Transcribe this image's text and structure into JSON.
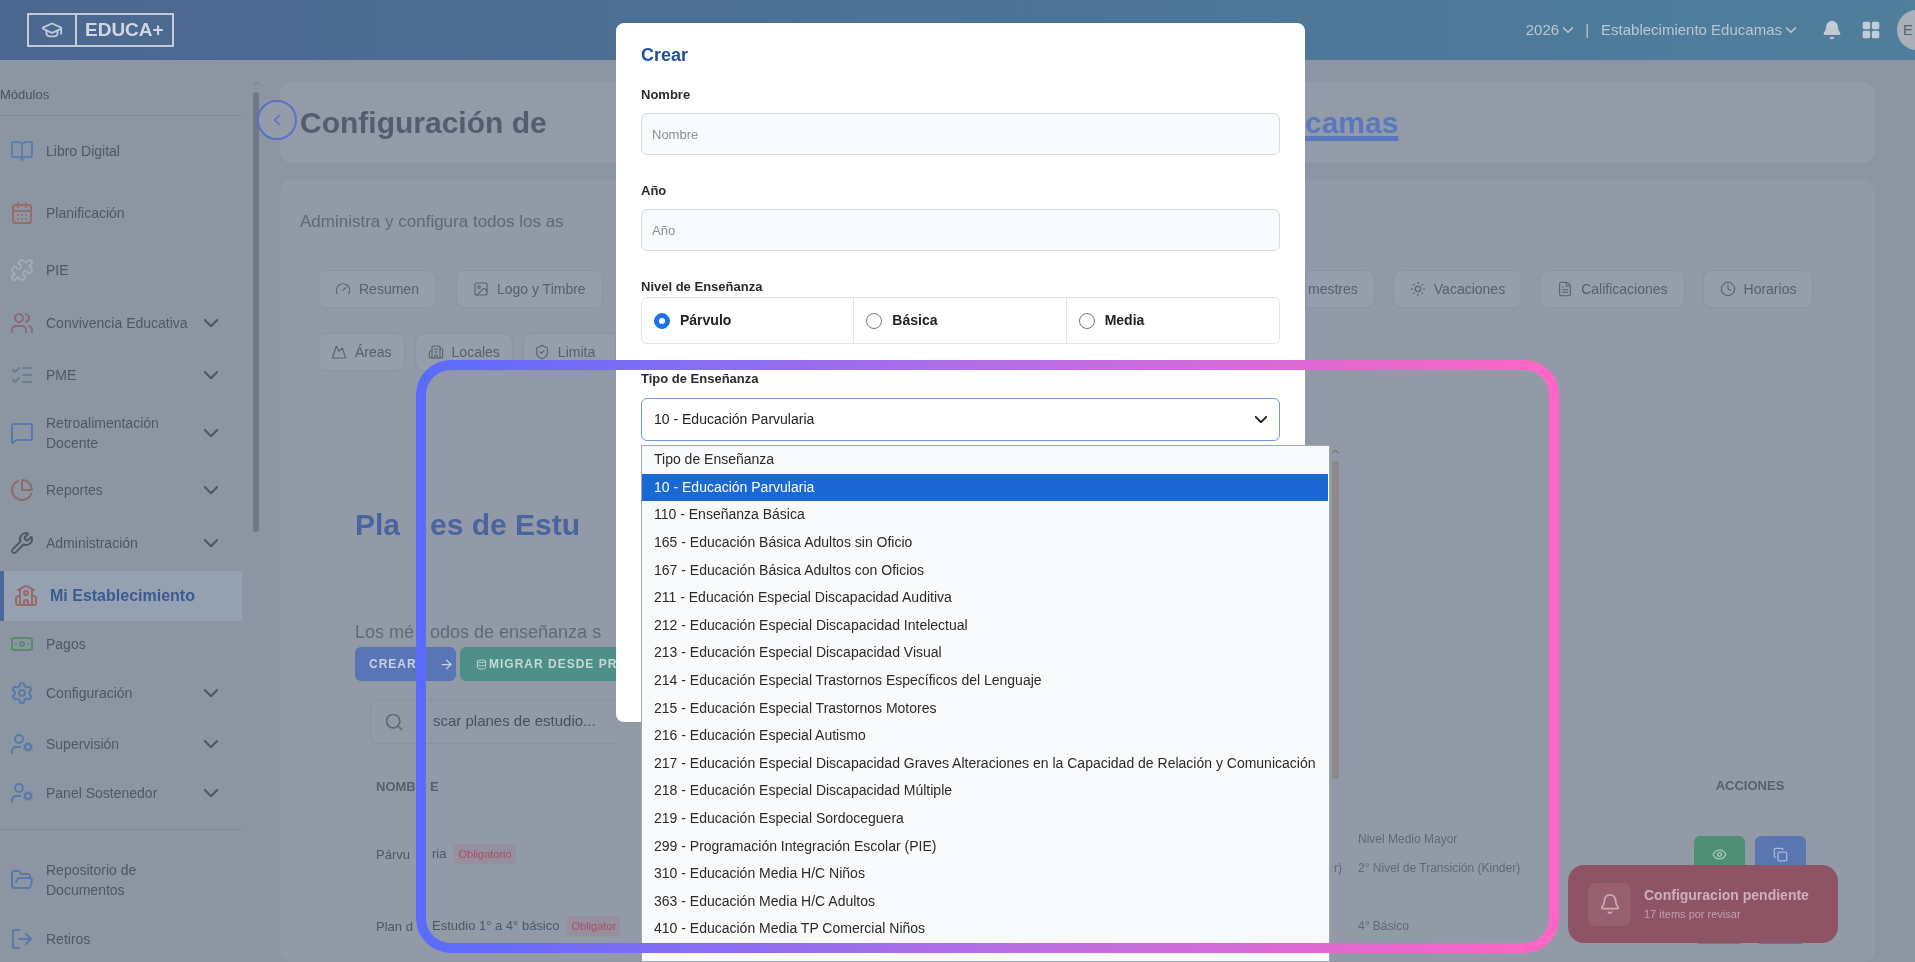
{
  "top_bar": {
    "logo_text": "EDUCA+",
    "year": "2026",
    "separator": "|",
    "establishment": "Establecimiento Educamas",
    "avatar_initials": "E"
  },
  "sidebar": {
    "section_label": "Módulos",
    "items": [
      {
        "label": "Libro Digital",
        "expandable": false,
        "selected": false
      },
      {
        "label": "Planificación",
        "expandable": false,
        "selected": false
      },
      {
        "label": "PIE",
        "expandable": false,
        "selected": false
      },
      {
        "label": "Convivencia Educativa",
        "expandable": true,
        "selected": false
      },
      {
        "label": "PME",
        "expandable": true,
        "selected": false
      },
      {
        "label": "Retroalimentación Docente",
        "expandable": true,
        "selected": false
      },
      {
        "label": "Reportes",
        "expandable": true,
        "selected": false
      },
      {
        "label": "Administración",
        "expandable": true,
        "selected": false
      },
      {
        "label": "Mi Establecimiento",
        "expandable": false,
        "selected": true
      },
      {
        "label": "Pagos",
        "expandable": false,
        "selected": false
      },
      {
        "label": "Configuración",
        "expandable": true,
        "selected": false
      },
      {
        "label": "Supervisión",
        "expandable": true,
        "selected": false
      },
      {
        "label": "Panel Sostenedor",
        "expandable": true,
        "selected": false
      }
    ],
    "footer_items": [
      {
        "label": "Repositorio de Documentos"
      },
      {
        "label": "Retiros"
      }
    ]
  },
  "header": {
    "title_visible": "Configuración de",
    "title_link_visible": "camas"
  },
  "content": {
    "subtitle_visible": "Administra y configura todos los as",
    "tabs_row_1_left": [
      "Resumen",
      "Logo y Timbre"
    ],
    "tabs_row_1_right": [
      "mestres",
      "Vacaciones",
      "Calificaciones",
      "Horarios"
    ],
    "tabs_row_2": [
      "Áreas",
      "Locales",
      "Limita"
    ],
    "section_title_parts": [
      "Pla",
      "es de Estu"
    ],
    "description_parts": [
      "Los mé",
      "odos de enseñanza s"
    ],
    "create_button": "CREAR",
    "migrate_button_visible": "MIGRAR DESDE PR",
    "search_placeholder_visible": "scar planes de estudio...",
    "table": {
      "name_header_parts": [
        "NOMB",
        "E"
      ],
      "actions_header": "ACCIONES",
      "rows": [
        {
          "name_parts": [
            "Párvu",
            "ria"
          ],
          "badge": "Obligatorio",
          "levels": [
            "Nivel Medio Mayor",
            "2° Nivel de Transición (Kinder)"
          ],
          "cut_text": "r)"
        },
        {
          "name_parts": [
            "Plan d",
            "Estudio 1° a 4° básico"
          ],
          "badge": "Obligator",
          "levels": [
            "4° Básico"
          ]
        }
      ]
    }
  },
  "modal": {
    "title": "Crear",
    "fields": [
      {
        "label": "Nombre",
        "placeholder": "Nombre"
      },
      {
        "label": "Año",
        "placeholder": "Año"
      }
    ],
    "level_group": {
      "label": "Nivel de Enseñanza",
      "options": [
        {
          "label": "Párvulo",
          "selected": true
        },
        {
          "label": "Básica",
          "selected": false
        },
        {
          "label": "Media",
          "selected": false
        }
      ]
    },
    "type_select": {
      "label": "Tipo de Enseñanza",
      "value": "10 - Educación Parvularia"
    }
  },
  "dropdown": {
    "options": [
      {
        "label": "Tipo de Enseñanza",
        "selected": false
      },
      {
        "label": "10 - Educación Parvularia",
        "selected": true
      },
      {
        "label": "110 - Enseñanza Básica",
        "selected": false
      },
      {
        "label": "165 - Educación Básica Adultos sin Oficio",
        "selected": false
      },
      {
        "label": "167 - Educación Básica Adultos con Oficios",
        "selected": false
      },
      {
        "label": "211 - Educación Especial Discapacidad Auditiva",
        "selected": false
      },
      {
        "label": "212 - Educación Especial Discapacidad Intelectual",
        "selected": false
      },
      {
        "label": "213 - Educación Especial Discapacidad Visual",
        "selected": false
      },
      {
        "label": "214 - Educación Especial Trastornos Específicos del Lenguaje",
        "selected": false
      },
      {
        "label": "215 - Educación Especial Trastornos Motores",
        "selected": false
      },
      {
        "label": "216 - Educación Especial Autismo",
        "selected": false
      },
      {
        "label": "217 - Educación Especial Discapacidad Graves Alteraciones en la Capacidad de Relación y Comunicación",
        "selected": false
      },
      {
        "label": "218 - Educación Especial Discapacidad Múltiple",
        "selected": false
      },
      {
        "label": "219 - Educación Especial Sordoceguera",
        "selected": false
      },
      {
        "label": "299 - Programación Integración Escolar (PIE)",
        "selected": false
      },
      {
        "label": "310 - Educación Media H/C Niños",
        "selected": false
      },
      {
        "label": "363 - Educación Media H/C Adultos",
        "selected": false
      },
      {
        "label": "410 - Educación Media TP Comercial Niños",
        "selected": false
      }
    ]
  },
  "toast": {
    "title": "Configuracion pendiente",
    "subtitle": "17 items por revisar"
  }
}
